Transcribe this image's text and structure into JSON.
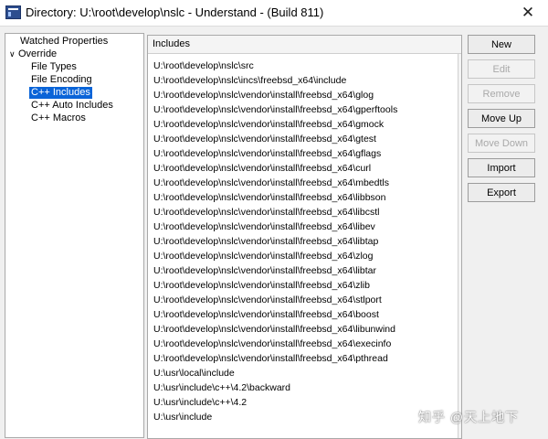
{
  "window": {
    "title": "Directory: U:\\root\\develop\\nslc - Understand - (Build 811)",
    "close_glyph": "✕"
  },
  "tree": {
    "items": [
      {
        "label": "Watched Properties"
      },
      {
        "label": "Override",
        "arrow": "∨"
      },
      {
        "label": "File Types"
      },
      {
        "label": "File Encoding"
      },
      {
        "label": "C++ Includes"
      },
      {
        "label": "C++ Auto Includes"
      },
      {
        "label": "C++ Macros"
      }
    ]
  },
  "includes": {
    "header": "Includes",
    "paths": [
      "U:\\root\\develop\\nslc\\src",
      "U:\\root\\develop\\nslc\\incs\\freebsd_x64\\include",
      "U:\\root\\develop\\nslc\\vendor\\install\\freebsd_x64\\glog",
      "U:\\root\\develop\\nslc\\vendor\\install\\freebsd_x64\\gperftools",
      "U:\\root\\develop\\nslc\\vendor\\install\\freebsd_x64\\gmock",
      "U:\\root\\develop\\nslc\\vendor\\install\\freebsd_x64\\gtest",
      "U:\\root\\develop\\nslc\\vendor\\install\\freebsd_x64\\gflags",
      "U:\\root\\develop\\nslc\\vendor\\install\\freebsd_x64\\curl",
      "U:\\root\\develop\\nslc\\vendor\\install\\freebsd_x64\\mbedtls",
      "U:\\root\\develop\\nslc\\vendor\\install\\freebsd_x64\\libbson",
      "U:\\root\\develop\\nslc\\vendor\\install\\freebsd_x64\\libcstl",
      "U:\\root\\develop\\nslc\\vendor\\install\\freebsd_x64\\libev",
      "U:\\root\\develop\\nslc\\vendor\\install\\freebsd_x64\\libtap",
      "U:\\root\\develop\\nslc\\vendor\\install\\freebsd_x64\\zlog",
      "U:\\root\\develop\\nslc\\vendor\\install\\freebsd_x64\\libtar",
      "U:\\root\\develop\\nslc\\vendor\\install\\freebsd_x64\\zlib",
      "U:\\root\\develop\\nslc\\vendor\\install\\freebsd_x64\\stlport",
      "U:\\root\\develop\\nslc\\vendor\\install\\freebsd_x64\\boost",
      "U:\\root\\develop\\nslc\\vendor\\install\\freebsd_x64\\libunwind",
      "U:\\root\\develop\\nslc\\vendor\\install\\freebsd_x64\\execinfo",
      "U:\\root\\develop\\nslc\\vendor\\install\\freebsd_x64\\pthread",
      "U:\\usr\\local\\include",
      "U:\\usr\\include\\c++\\4.2\\backward",
      "U:\\usr\\include\\c++\\4.2",
      "U:\\usr\\include"
    ]
  },
  "buttons": {
    "new": "New",
    "edit": "Edit",
    "remove": "Remove",
    "move_up": "Move Up",
    "move_down": "Move Down",
    "import": "Import",
    "export": "Export"
  },
  "watermark": "知乎 @天上地下"
}
